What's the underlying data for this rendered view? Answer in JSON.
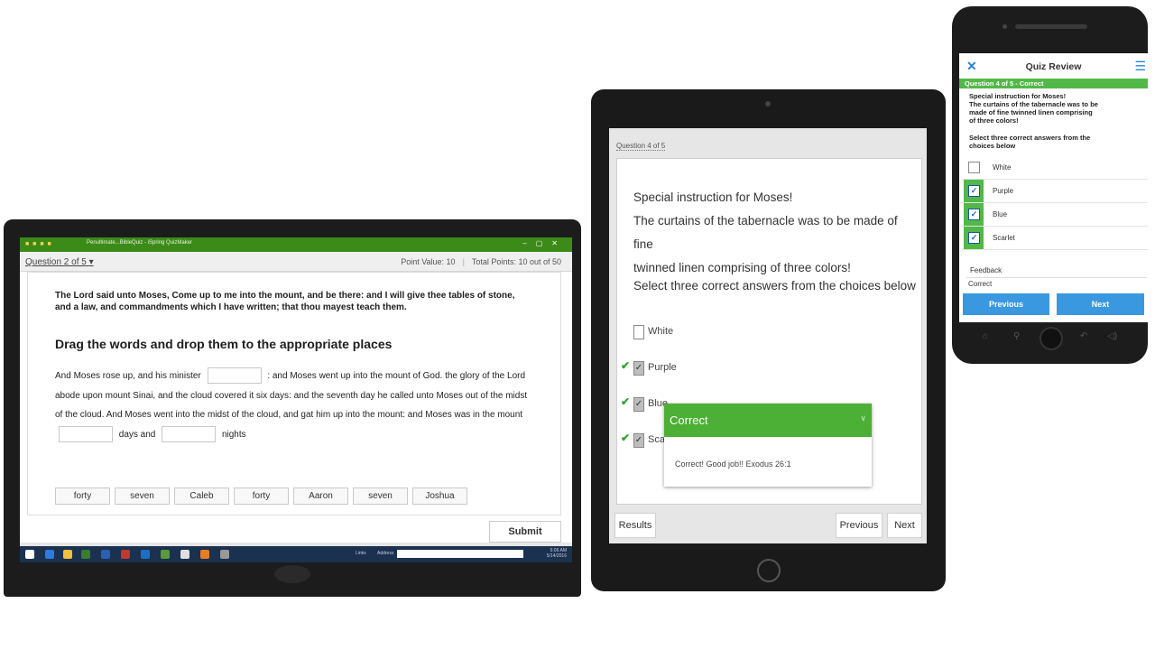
{
  "laptop": {
    "window_title": "Penultimate...BibleQuiz - iSpring QuizMaker",
    "question_selector": "Question 2 of 5",
    "point_value": "Point Value: 10",
    "total_points": "Total Points: 10 out of 50",
    "instruction": "The Lord said unto Moses, Come up to me into the mount, and be there: and I will give thee tables of stone, and a law, and commandments which I have written; that thou mayest teach them.",
    "heading": "Drag the words and drop them to the appropriate places",
    "para": {
      "p1": "And Moses rose up, and his minister",
      "p2": ": and Moses went up into the mount of God. the glory of the Lord abode upon mount Sinai, and the cloud covered it six days: and the seventh day he called unto Moses out of the midst of the cloud. And Moses went into the midst of the cloud, and gat him up into the mount: and Moses was in the mount",
      "p3": "days and",
      "p4": "nights"
    },
    "words": [
      "forty",
      "seven",
      "Caleb",
      "forty",
      "Aaron",
      "seven",
      "Joshua"
    ],
    "submit_label": "Submit",
    "taskbar": {
      "links_label": "Links",
      "address_label": "Address",
      "time": "6:06 AM",
      "date": "5/14/2016"
    }
  },
  "tablet": {
    "question_label": "Question 4 of 5",
    "instruction_lines": [
      "Special instruction for Moses!",
      "The curtains of the tabernacle was to be made of fine",
      "twinned linen comprising of three colors!"
    ],
    "select_text": "Select three correct answers from the choices below",
    "options": [
      {
        "label": "White",
        "checked": false,
        "correct": false
      },
      {
        "label": "Purple",
        "checked": true,
        "correct": true
      },
      {
        "label": "Blue",
        "checked": true,
        "correct": true
      },
      {
        "label": "Scarlet",
        "checked": true,
        "correct": true
      }
    ],
    "popup": {
      "title": "Correct",
      "body": "Correct! Good job!! Exodus 26:1"
    },
    "results_label": "Results",
    "previous_label": "Previous",
    "next_label": "Next",
    "colors": {
      "correct_green": "#4caf36"
    }
  },
  "phone": {
    "title": "Quiz Review",
    "status": "Question 4 of 5 - Correct",
    "instruction_lines": [
      "Special instruction for Moses!",
      "The curtains of the tabernacle was to be",
      "made of fine twinned linen comprising",
      "of three colors!"
    ],
    "select_lines": [
      "Select three correct answers from the",
      "choices below"
    ],
    "options": [
      {
        "label": "White",
        "checked": false
      },
      {
        "label": "Purple",
        "checked": true
      },
      {
        "label": "Blue",
        "checked": true
      },
      {
        "label": "Scarlet",
        "checked": true
      }
    ],
    "feedback_label": "Feedback",
    "feedback_value": "Correct",
    "previous_label": "Previous",
    "next_label": "Next",
    "colors": {
      "status_green": "#52b848",
      "button_blue": "#3a98e0"
    }
  }
}
